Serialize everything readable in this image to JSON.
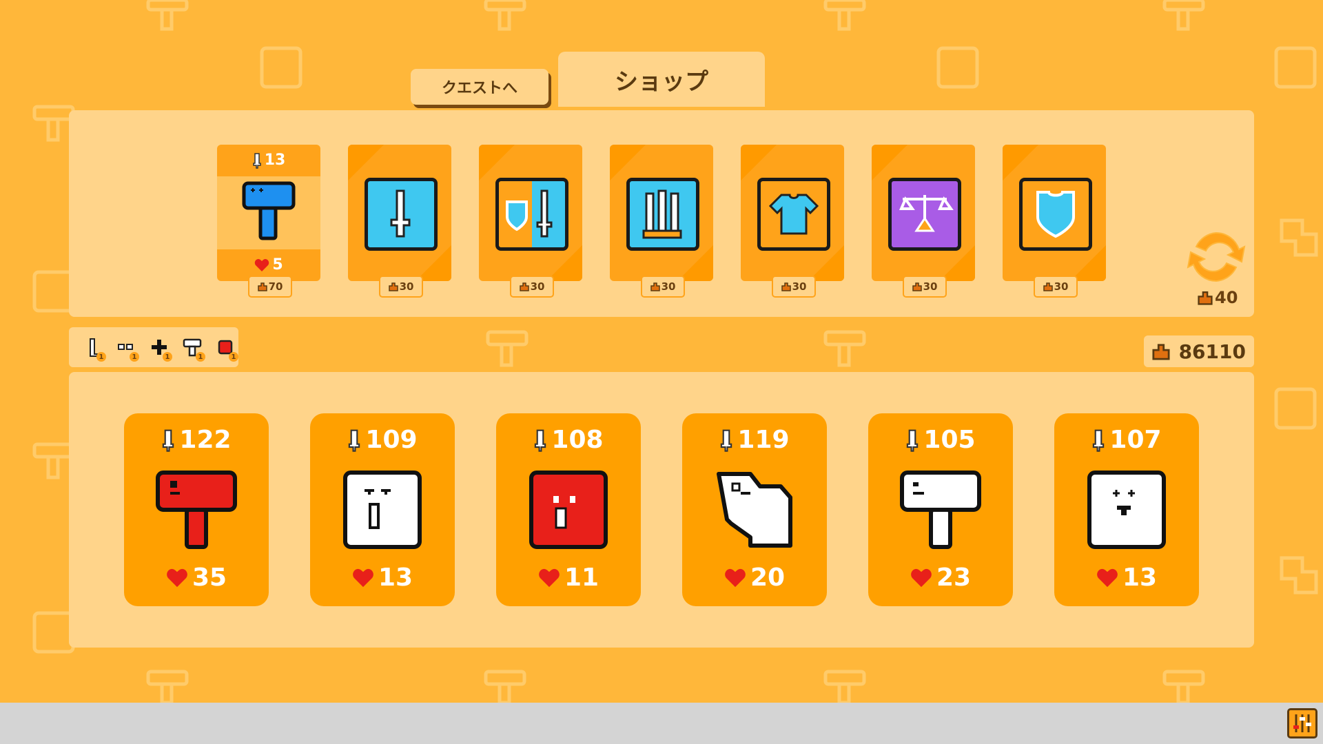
{
  "tabs": {
    "quest_label": "クエストへ",
    "shop_label": "ショップ"
  },
  "shop": {
    "unit_offer": {
      "attack": "13",
      "hp": "5",
      "price": "70",
      "sprite": "blue-hammer-icon"
    },
    "items": [
      {
        "icon": "sword-item-icon",
        "price": "30",
        "bg": "#3FC8F0"
      },
      {
        "icon": "shield-sword-item-icon",
        "price": "30",
        "bg": "#FFA31A"
      },
      {
        "icon": "triple-blade-item-icon",
        "price": "30",
        "bg": "#3FC8F0"
      },
      {
        "icon": "shirt-item-icon",
        "price": "30",
        "bg": "#FFA31A"
      },
      {
        "icon": "scale-item-icon",
        "price": "30",
        "bg": "#A95CE6"
      },
      {
        "icon": "shield-item-icon",
        "price": "30",
        "bg": "#FFA31A"
      }
    ],
    "refresh_cost": "40"
  },
  "tags": [
    {
      "icon": "blade-tag-icon",
      "count": "1"
    },
    {
      "icon": "eyes-tag-icon",
      "count": "1"
    },
    {
      "icon": "plus-tag-icon",
      "count": "1"
    },
    {
      "icon": "hammer-tag-icon",
      "count": "1"
    },
    {
      "icon": "red-square-tag-icon",
      "count": "1"
    }
  ],
  "gold": "86110",
  "party": [
    {
      "attack": "122",
      "hp": "35",
      "sprite": "red-hammer-unit-icon"
    },
    {
      "attack": "109",
      "hp": "13",
      "sprite": "white-block-unit-icon"
    },
    {
      "attack": "108",
      "hp": "11",
      "sprite": "red-block-unit-icon"
    },
    {
      "attack": "119",
      "hp": "20",
      "sprite": "white-boot-unit-icon"
    },
    {
      "attack": "105",
      "hp": "23",
      "sprite": "white-hammer-unit-icon"
    },
    {
      "attack": "107",
      "hp": "13",
      "sprite": "white-face-unit-icon"
    }
  ],
  "colors": {
    "background": "#FFB73A",
    "panel": "#FFD48A",
    "card": "#FFA000",
    "heart": "#E8201A"
  }
}
